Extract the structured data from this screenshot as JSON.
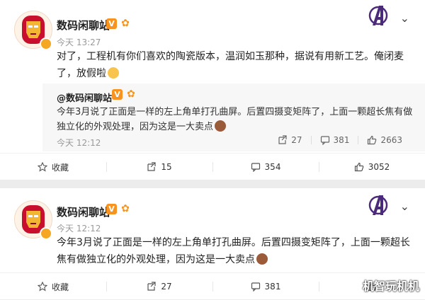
{
  "posts": [
    {
      "username": "数码闲聊站",
      "vip_badge": "V",
      "timestamp": "今天 13:27",
      "body": "对了，工程机有你们喜欢的陶瓷版本，温润如玉那种，据说有用新工艺。俺闭麦了，放假啦",
      "body_emoji": "grin-emoji",
      "repost": {
        "username": "@数码闲聊站",
        "vip_badge": "V",
        "text": "今年3月说了正面是一样的左上角单打孔曲屏。后置四摄变矩阵了，上面一颗超长焦有做独立化的外观处理，因为这是一大卖点",
        "text_emoji": "monkey-emoji",
        "timestamp": "今天 12:12",
        "reposts": "27",
        "comments": "381",
        "likes": "2663"
      },
      "actions": {
        "favorite_label": "收藏",
        "reposts": "15",
        "comments": "354",
        "likes": "3052"
      }
    },
    {
      "username": "数码闲聊站",
      "vip_badge": "V",
      "timestamp": "今天 12:12",
      "body": "今年3月说了正面是一样的左上角单打孔曲屏。后置四摄变矩阵了，上面一颗超长焦有做独立化的外观处理，因为这是一大卖点",
      "body_emoji": "monkey-emoji",
      "actions": {
        "favorite_label": "收藏",
        "reposts": "27",
        "comments": "381"
      }
    }
  ],
  "watermark": "机智玩机机",
  "colors": {
    "accent_orange": "#f7931e",
    "avatar_red": "#c8102e",
    "avatar_gold": "#f2b632",
    "avengers_purple": "#4b2a7a"
  }
}
